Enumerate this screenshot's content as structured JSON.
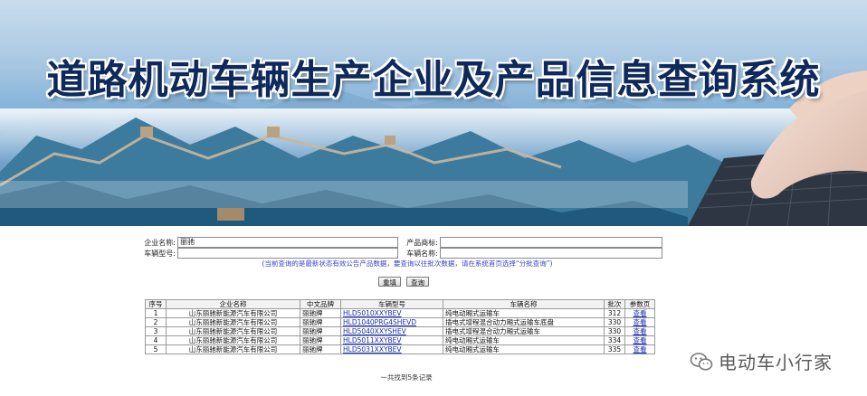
{
  "banner": {
    "title": "道路机动车辆生产企业及产品信息查询系统"
  },
  "form": {
    "company_label": "企业名称:",
    "company_value": "丽驰",
    "trademark_label": "产品商标:",
    "trademark_value": "",
    "model_label": "车辆型号:",
    "model_value": "",
    "vehicle_name_label": "车辆名称:",
    "vehicle_name_value": "",
    "notice": "(当前查询的是最新状态有效公告产品数据，要查询以往批次数据，请在系统首页选择“分批查询”)",
    "reset_label": "重填",
    "search_label": "查询"
  },
  "table": {
    "headers": [
      "序号",
      "企业名称",
      "中文品牌",
      "车辆型号",
      "车辆名称",
      "批次",
      "参数页"
    ],
    "rows": [
      {
        "no": "1",
        "company": "山东丽驰新能源汽车有限公司",
        "brand": "丽驰牌",
        "model": "HLD5010XXYBEV",
        "name": "纯电动厢式运输车",
        "batch": "312",
        "action": "查看"
      },
      {
        "no": "2",
        "company": "山东丽驰新能源汽车有限公司",
        "brand": "丽驰牌",
        "model": "HLD1040PRG4SHEVD",
        "name": "插电式增程混合动力厢式运输车底盘",
        "batch": "330",
        "action": "查看"
      },
      {
        "no": "3",
        "company": "山东丽驰新能源汽车有限公司",
        "brand": "丽驰牌",
        "model": "HLD5040XXYSHEV",
        "name": "插电式增程混合动力厢式运输车",
        "batch": "330",
        "action": "查看"
      },
      {
        "no": "4",
        "company": "山东丽驰新能源汽车有限公司",
        "brand": "丽驰牌",
        "model": "HLD5011XXYBEV",
        "name": "纯电动厢式运输车",
        "batch": "334",
        "action": "查看"
      },
      {
        "no": "5",
        "company": "山东丽驰新能源汽车有限公司",
        "brand": "丽驰牌",
        "model": "HLD5031XXYBEV",
        "name": "纯电动厢式运输车",
        "batch": "335",
        "action": "查看"
      }
    ],
    "footer": "一共找到5条记录"
  },
  "watermark": {
    "icon": "wechat-icon",
    "text": "电动车小行家"
  },
  "colors": {
    "link": "#1a2fb0",
    "notice": "#3344cc",
    "title": "#0f2a5a"
  }
}
